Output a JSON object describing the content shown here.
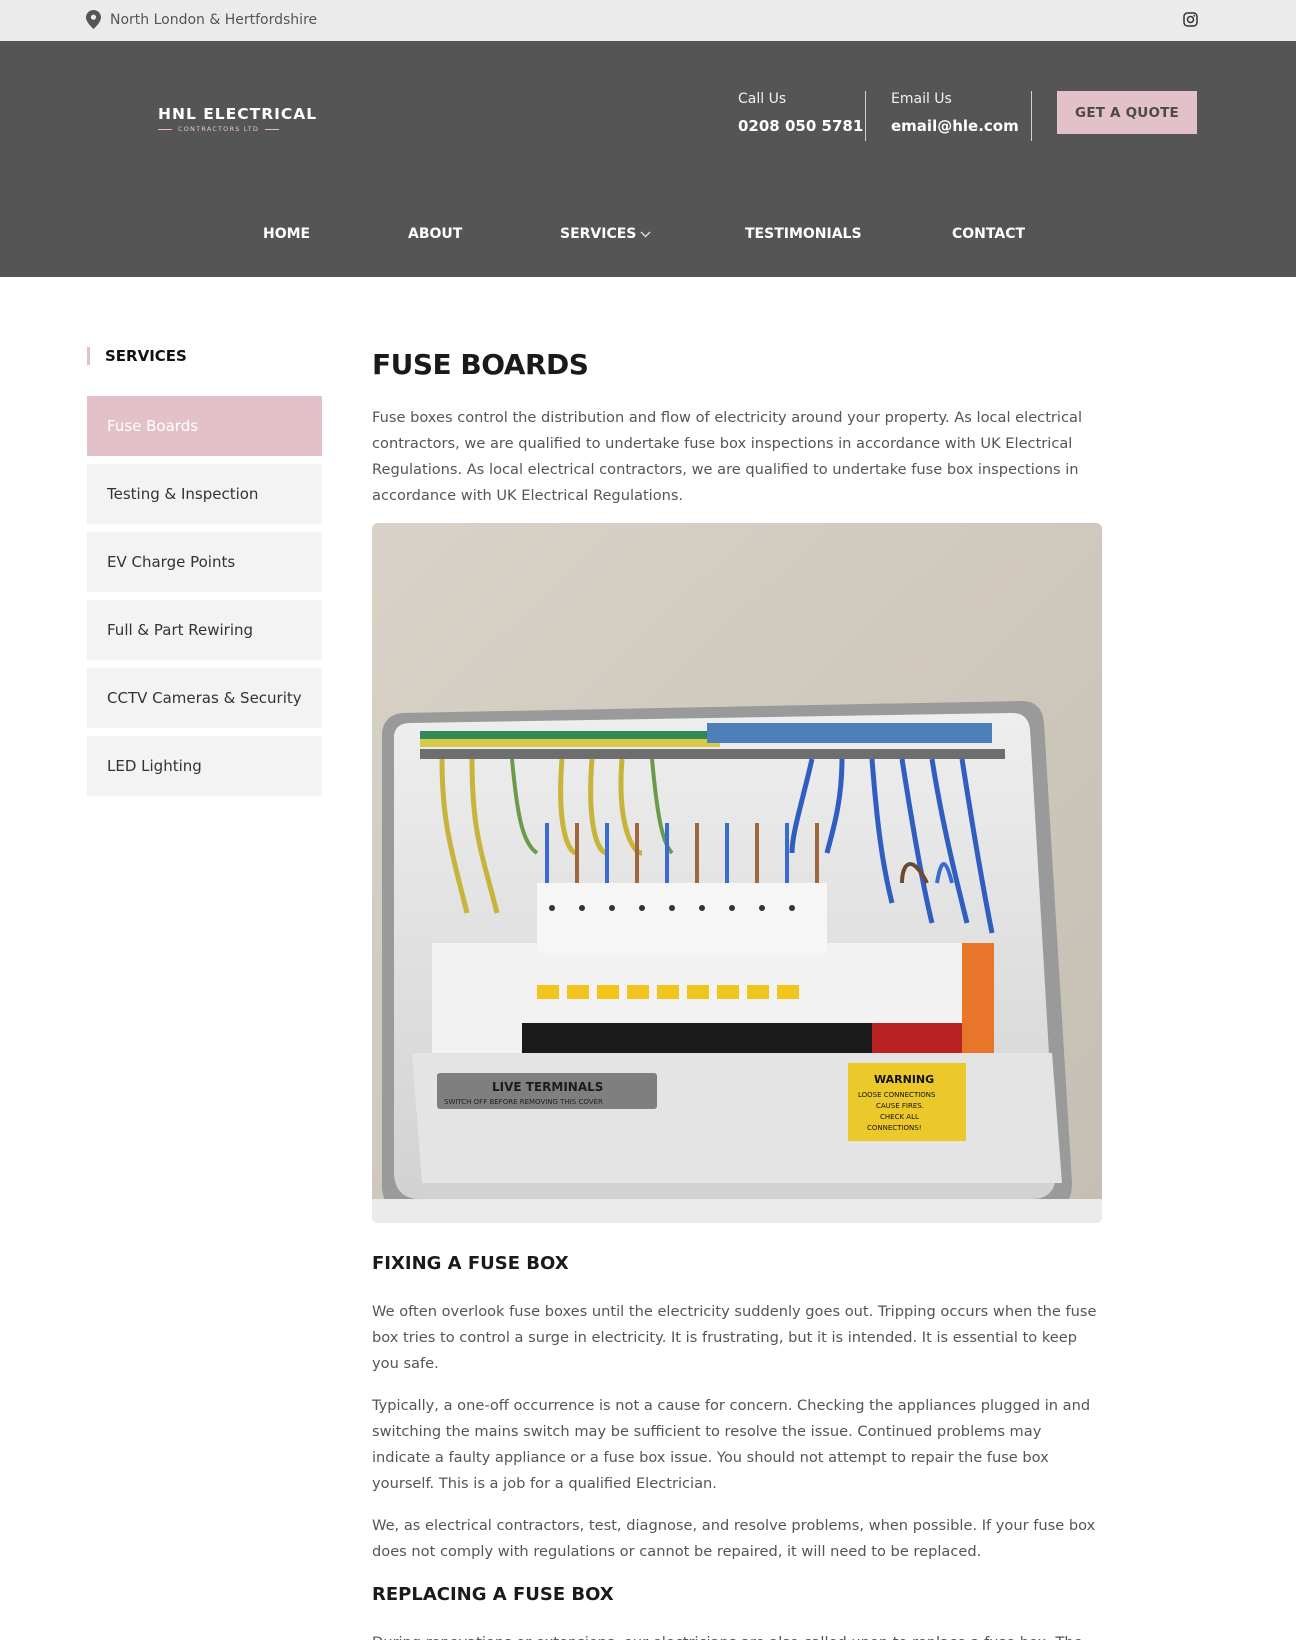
{
  "topbar": {
    "location": "North London & Hertfordshire",
    "social_icon": "instagram-icon"
  },
  "header": {
    "logo": {
      "line1": "HNL ELECTRICAL",
      "line2": "CONTRACTORS LTD"
    },
    "call": {
      "label": "Call Us",
      "value": "0208 050 5781"
    },
    "email": {
      "label": "Email Us",
      "value": "email@hle.com"
    },
    "quote_button": "GET A QUOTE"
  },
  "nav": [
    {
      "label": "HOME"
    },
    {
      "label": "ABOUT"
    },
    {
      "label": "SERVICES"
    },
    {
      "label": "TESTIMONIALS"
    },
    {
      "label": "CONTACT"
    }
  ],
  "sidebar": {
    "title": "SERVICES",
    "items": [
      {
        "label": "Fuse Boards",
        "active": true
      },
      {
        "label": "Testing & Inspection"
      },
      {
        "label": "EV Charge Points"
      },
      {
        "label": "Full & Part Rewiring"
      },
      {
        "label": "CCTV Cameras & Security"
      },
      {
        "label": "LED Lighting"
      }
    ]
  },
  "main": {
    "title": "FUSE BOARDS",
    "intro": "Fuse boxes control the distribution and flow of electricity around your property. As local electrical contractors, we are qualified to undertake fuse box inspections in accordance with UK Electrical Regulations. As local electrical contractors, we are qualified to undertake fuse box inspections in accordance with UK Electrical Regulations.",
    "photo": {
      "label_left_1": "LIVE TERMINALS",
      "label_left_2": "SWITCH OFF BEFORE REMOVING THIS COVER",
      "label_right_1": "WARNING",
      "label_right_2": "LOOSE CONNECTIONS",
      "label_right_3": "CAUSE FIRES.",
      "label_right_4": "CHECK ALL",
      "label_right_5": "CONNECTIONS!"
    },
    "section1": {
      "heading": "FIXING A FUSE BOX",
      "p1": "We often overlook fuse boxes until the electricity suddenly goes out. Tripping occurs when the fuse box tries to control a surge in electricity. It is frustrating, but it is intended. It is essential to keep you safe.",
      "p2": "Typically, a one-off occurrence is not a cause for concern. Checking the appliances plugged in and switching the mains switch may be sufficient to resolve the issue. Continued problems may indicate a faulty appliance or a fuse box issue. You should not attempt to repair the fuse box yourself. This is a job for a qualified Electrician.",
      "p3": "We, as electrical contractors, test, diagnose, and resolve problems, when possible. If your fuse box does not comply with regulations or cannot be repaired, it will need to be replaced."
    },
    "section2": {
      "heading": "REPLACING A FUSE BOX",
      "p1": "During renovations or extensions, our electricians are also called upon to replace a fuse box. The current fuse box may not be sufficient if you plan on adding more electrical outlets, switches, and"
    }
  }
}
